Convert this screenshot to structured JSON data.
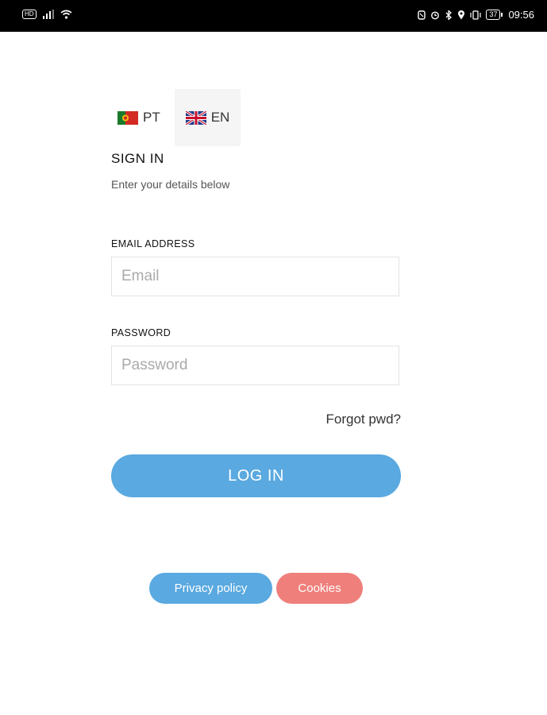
{
  "status_bar": {
    "left_badge": "HD",
    "time": "09:56",
    "battery": "37"
  },
  "language": {
    "pt_label": "PT",
    "en_label": "EN",
    "selected": "EN"
  },
  "signin": {
    "title": "SIGN IN",
    "subtitle": "Enter your details below"
  },
  "form": {
    "email_label": "EMAIL ADDRESS",
    "email_placeholder": "Email",
    "password_label": "PASSWORD",
    "password_placeholder": "Password",
    "forgot_label": "Forgot pwd?",
    "login_label": "LOG IN"
  },
  "footer": {
    "privacy_label": "Privacy policy",
    "cookies_label": "Cookies"
  },
  "colors": {
    "primary": "#5aa9e0",
    "cookies": "#ef7f7a"
  },
  "icons": [
    "signal-icon",
    "wifi-icon",
    "nfc-icon",
    "alarm-icon",
    "bluetooth-icon",
    "location-icon",
    "vibrate-icon",
    "battery-icon",
    "portugal-flag-icon",
    "uk-flag-icon",
    "caret-down-icon"
  ]
}
